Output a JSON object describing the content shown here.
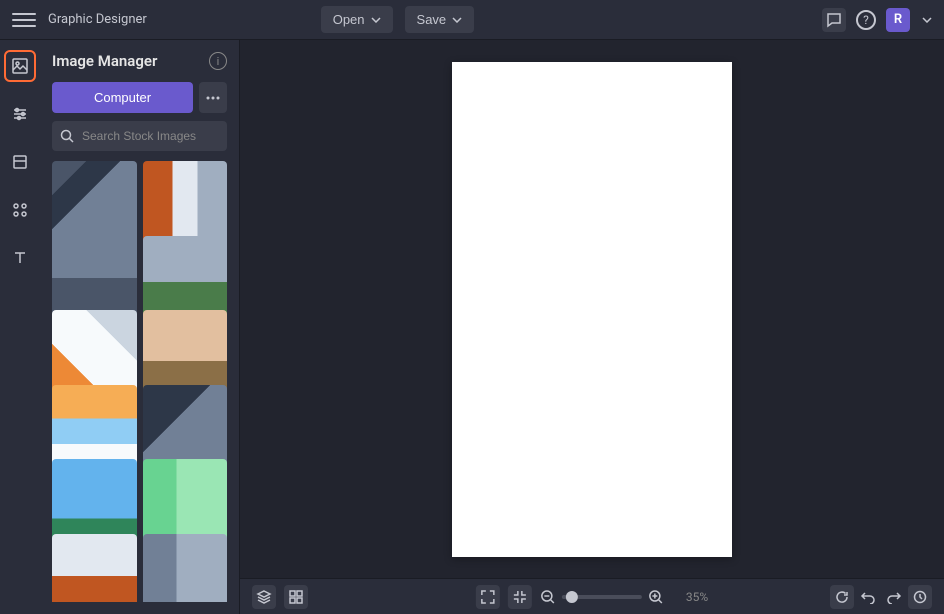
{
  "app_title": "Graphic Designer",
  "topbar": {
    "open": "Open",
    "save": "Save",
    "user_initial": "R"
  },
  "panel": {
    "title": "Image Manager",
    "computer_btn": "Computer",
    "search_placeholder": "Search Stock Images",
    "thumbs": [
      {
        "name": "paint-tray-rollers"
      },
      {
        "name": "ladder-orange-paint"
      },
      {
        "name": "cathedral-scaffolding"
      },
      {
        "name": "chateau-lawn"
      },
      {
        "name": "samples-notebook"
      },
      {
        "name": "people-interior"
      },
      {
        "name": "airplane-wing-clouds"
      },
      {
        "name": "passports-hands"
      },
      {
        "name": "glass-skyscraper"
      },
      {
        "name": "tree-sidewalk-person"
      },
      {
        "name": "interior-stairs"
      },
      {
        "name": "room-plants"
      }
    ]
  },
  "bottombar": {
    "zoom_percent": "35%"
  },
  "left_rail": [
    {
      "name": "image-manager-icon",
      "active": true
    },
    {
      "name": "adjust-icon",
      "active": false
    },
    {
      "name": "layout-icon",
      "active": false
    },
    {
      "name": "shapes-icon",
      "active": false
    },
    {
      "name": "text-icon",
      "active": false
    }
  ]
}
